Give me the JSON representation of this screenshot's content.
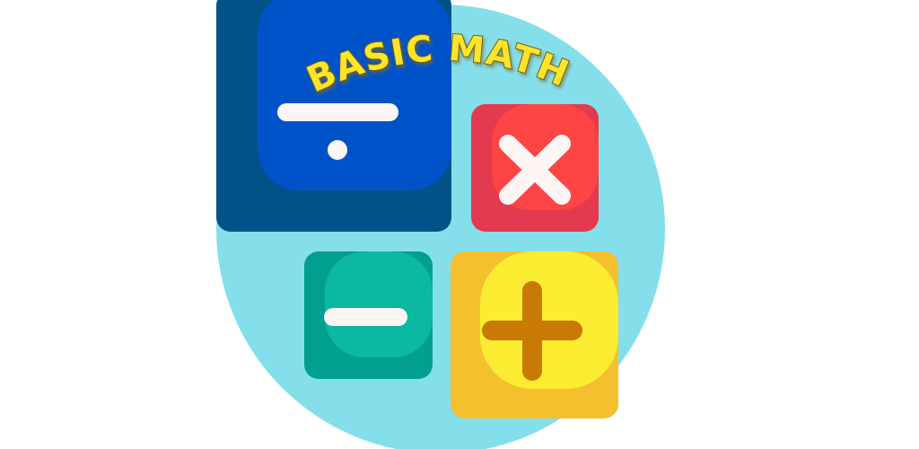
{
  "title": "BASIC MATH",
  "icons": [
    {
      "name": "divide-icon",
      "operator": "÷"
    },
    {
      "name": "multiply-icon",
      "operator": "×"
    },
    {
      "name": "minus-icon",
      "operator": "−"
    },
    {
      "name": "plus-icon",
      "operator": "+"
    }
  ],
  "colors": {
    "background": "#ffffff",
    "circle": "#84dfea",
    "divide_outer": "#025287",
    "divide_inner": "#0052c9",
    "multiply_outer": "#e33a4f",
    "multiply_inner": "#fe4444",
    "minus_outer": "#009f8f",
    "minus_inner": "#0bb8a1",
    "plus_outer": "#f4c02e",
    "plus_inner": "#fcec32",
    "plus_symbol": "#c97a04",
    "symbol_light": "#fdf6f5",
    "title_fill": "#ffe42a",
    "title_stroke": "#6a6020"
  }
}
